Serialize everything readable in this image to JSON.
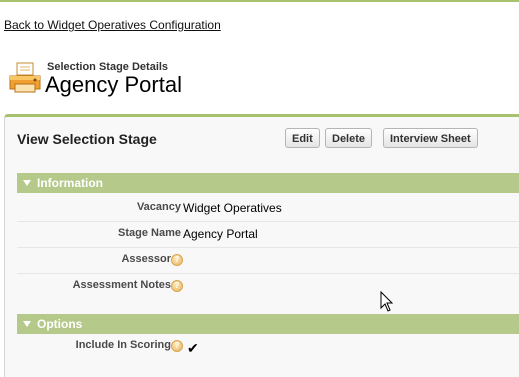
{
  "nav": {
    "back_link": "Back to Widget Operatives Configuration"
  },
  "header": {
    "subtitle": "Selection Stage Details",
    "title": "Agency Portal",
    "icon": "printer-icon"
  },
  "panel": {
    "title": "View Selection Stage",
    "buttons": {
      "edit": "Edit",
      "delete": "Delete",
      "interview_sheet": "Interview Sheet"
    }
  },
  "sections": {
    "information": {
      "title": "Information",
      "fields": {
        "vacancy": {
          "label": "Vacancy",
          "value": "Widget Operatives"
        },
        "stage_name": {
          "label": "Stage Name",
          "value": "Agency Portal"
        },
        "assessor": {
          "label": "Assessor",
          "value": ""
        },
        "assessment_notes": {
          "label": "Assessment Notes",
          "value": ""
        }
      }
    },
    "options": {
      "title": "Options",
      "fields": {
        "include_in_scoring": {
          "label": "Include In Scoring",
          "checked": true,
          "check_glyph": "✔"
        }
      }
    }
  },
  "colors": {
    "accent": "#a8c16f",
    "section_bar": "#b4c98a",
    "help_icon": "#e6b562"
  }
}
